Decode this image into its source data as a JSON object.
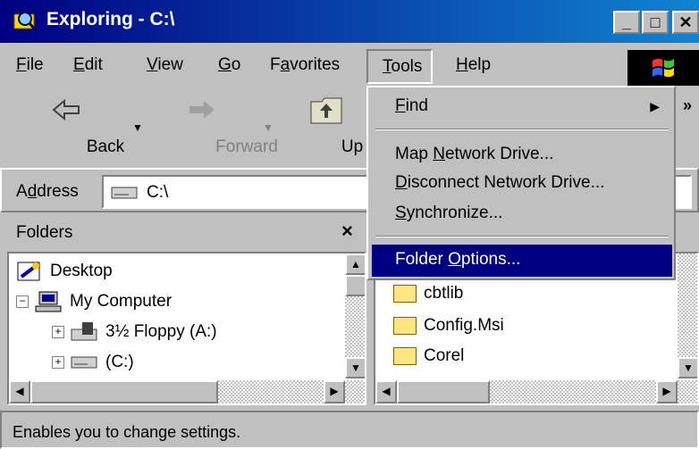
{
  "window": {
    "title": "Exploring - C:\\",
    "min": "_",
    "max": "□",
    "close": "✕"
  },
  "menubar": {
    "file": {
      "pre": "",
      "u": "F",
      "post": "ile"
    },
    "edit": {
      "pre": "",
      "u": "E",
      "post": "dit"
    },
    "view": {
      "pre": "",
      "u": "V",
      "post": "iew"
    },
    "go": {
      "pre": "",
      "u": "G",
      "post": "o"
    },
    "favorites": {
      "pre": "F",
      "u": "a",
      "post": "vorites"
    },
    "tools": {
      "pre": "",
      "u": "T",
      "post": "ools"
    },
    "help": {
      "pre": "",
      "u": "H",
      "post": "elp"
    }
  },
  "toolbar": {
    "back": "Back",
    "forward": "Forward",
    "up": "Up",
    "more": "»"
  },
  "address": {
    "label_pre": "A",
    "label_u": "d",
    "label_post": "dress",
    "value": "C:\\"
  },
  "folders": {
    "title": "Folders",
    "close": "×",
    "items": [
      {
        "label": "Desktop",
        "expander": ""
      },
      {
        "label": "My Computer",
        "expander": "−"
      },
      {
        "label": "3½ Floppy (A:)",
        "expander": "+"
      },
      {
        "label": "(C:)",
        "expander": "+"
      }
    ]
  },
  "files": {
    "items": [
      "cbtlib",
      "Config.Msi",
      "Corel"
    ]
  },
  "tools_menu": {
    "items": [
      {
        "pre": "",
        "u": "F",
        "post": "ind",
        "arrow": "▶"
      },
      {
        "pre": "Map ",
        "u": "N",
        "post": "etwork Drive..."
      },
      {
        "pre": "",
        "u": "D",
        "post": "isconnect Network Drive..."
      },
      {
        "pre": "",
        "u": "S",
        "post": "ynchronize..."
      },
      {
        "pre": "Folder ",
        "u": "O",
        "post": "ptions..."
      }
    ]
  },
  "status": {
    "text": "Enables you to change settings."
  },
  "colors": {
    "titlebar_start": "#000080",
    "titlebar_end": "#1084d0",
    "highlight": "#000080",
    "face": "#c0c0c0"
  }
}
